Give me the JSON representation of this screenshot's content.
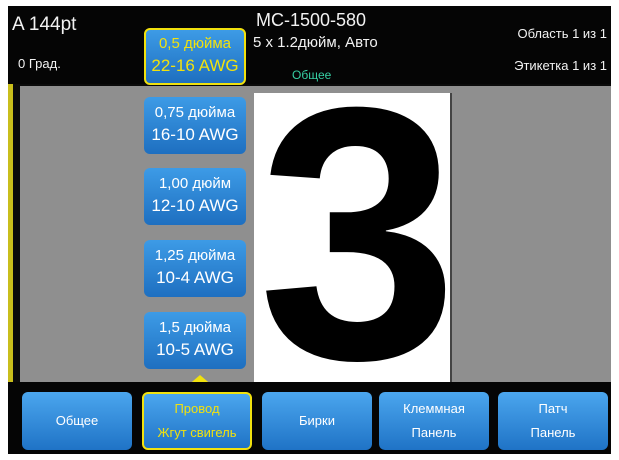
{
  "status": {
    "font_size": "A 144pt",
    "rotation": "0 Град.",
    "part": "MC-1500-580",
    "dimensions": "5 x 1.2дюйм, Авто",
    "category": "Общее",
    "area": "Область 1 из 1",
    "label": "Этикетка 1 из 1"
  },
  "label_text": "3",
  "sizes": [
    {
      "line1": "0,5 дюйма",
      "line2": "22-16 AWG",
      "selected": true
    },
    {
      "line1": "0,75 дюйма",
      "line2": "16-10 AWG",
      "selected": false
    },
    {
      "line1": "1,00 дюйм",
      "line2": "12-10 AWG",
      "selected": false
    },
    {
      "line1": "1,25 дюйма",
      "line2": "10-4 AWG",
      "selected": false
    },
    {
      "line1": "1,5 дюйма",
      "line2": "10-5 AWG",
      "selected": false
    }
  ],
  "tabs": [
    {
      "line1": "Общее",
      "line2": "",
      "selected": false
    },
    {
      "line1": "Провод",
      "line2": "Жгут свигель",
      "selected": true
    },
    {
      "line1": "Бирки",
      "line2": "",
      "selected": false
    },
    {
      "line1": "Клеммная",
      "line2": "Панель",
      "selected": false
    },
    {
      "line1": "Патч",
      "line2": "Панель",
      "selected": false
    }
  ],
  "colors": {
    "accent": "#f1e10e",
    "button_blue": "#2f8ad9",
    "category_green": "#36d0a4"
  }
}
